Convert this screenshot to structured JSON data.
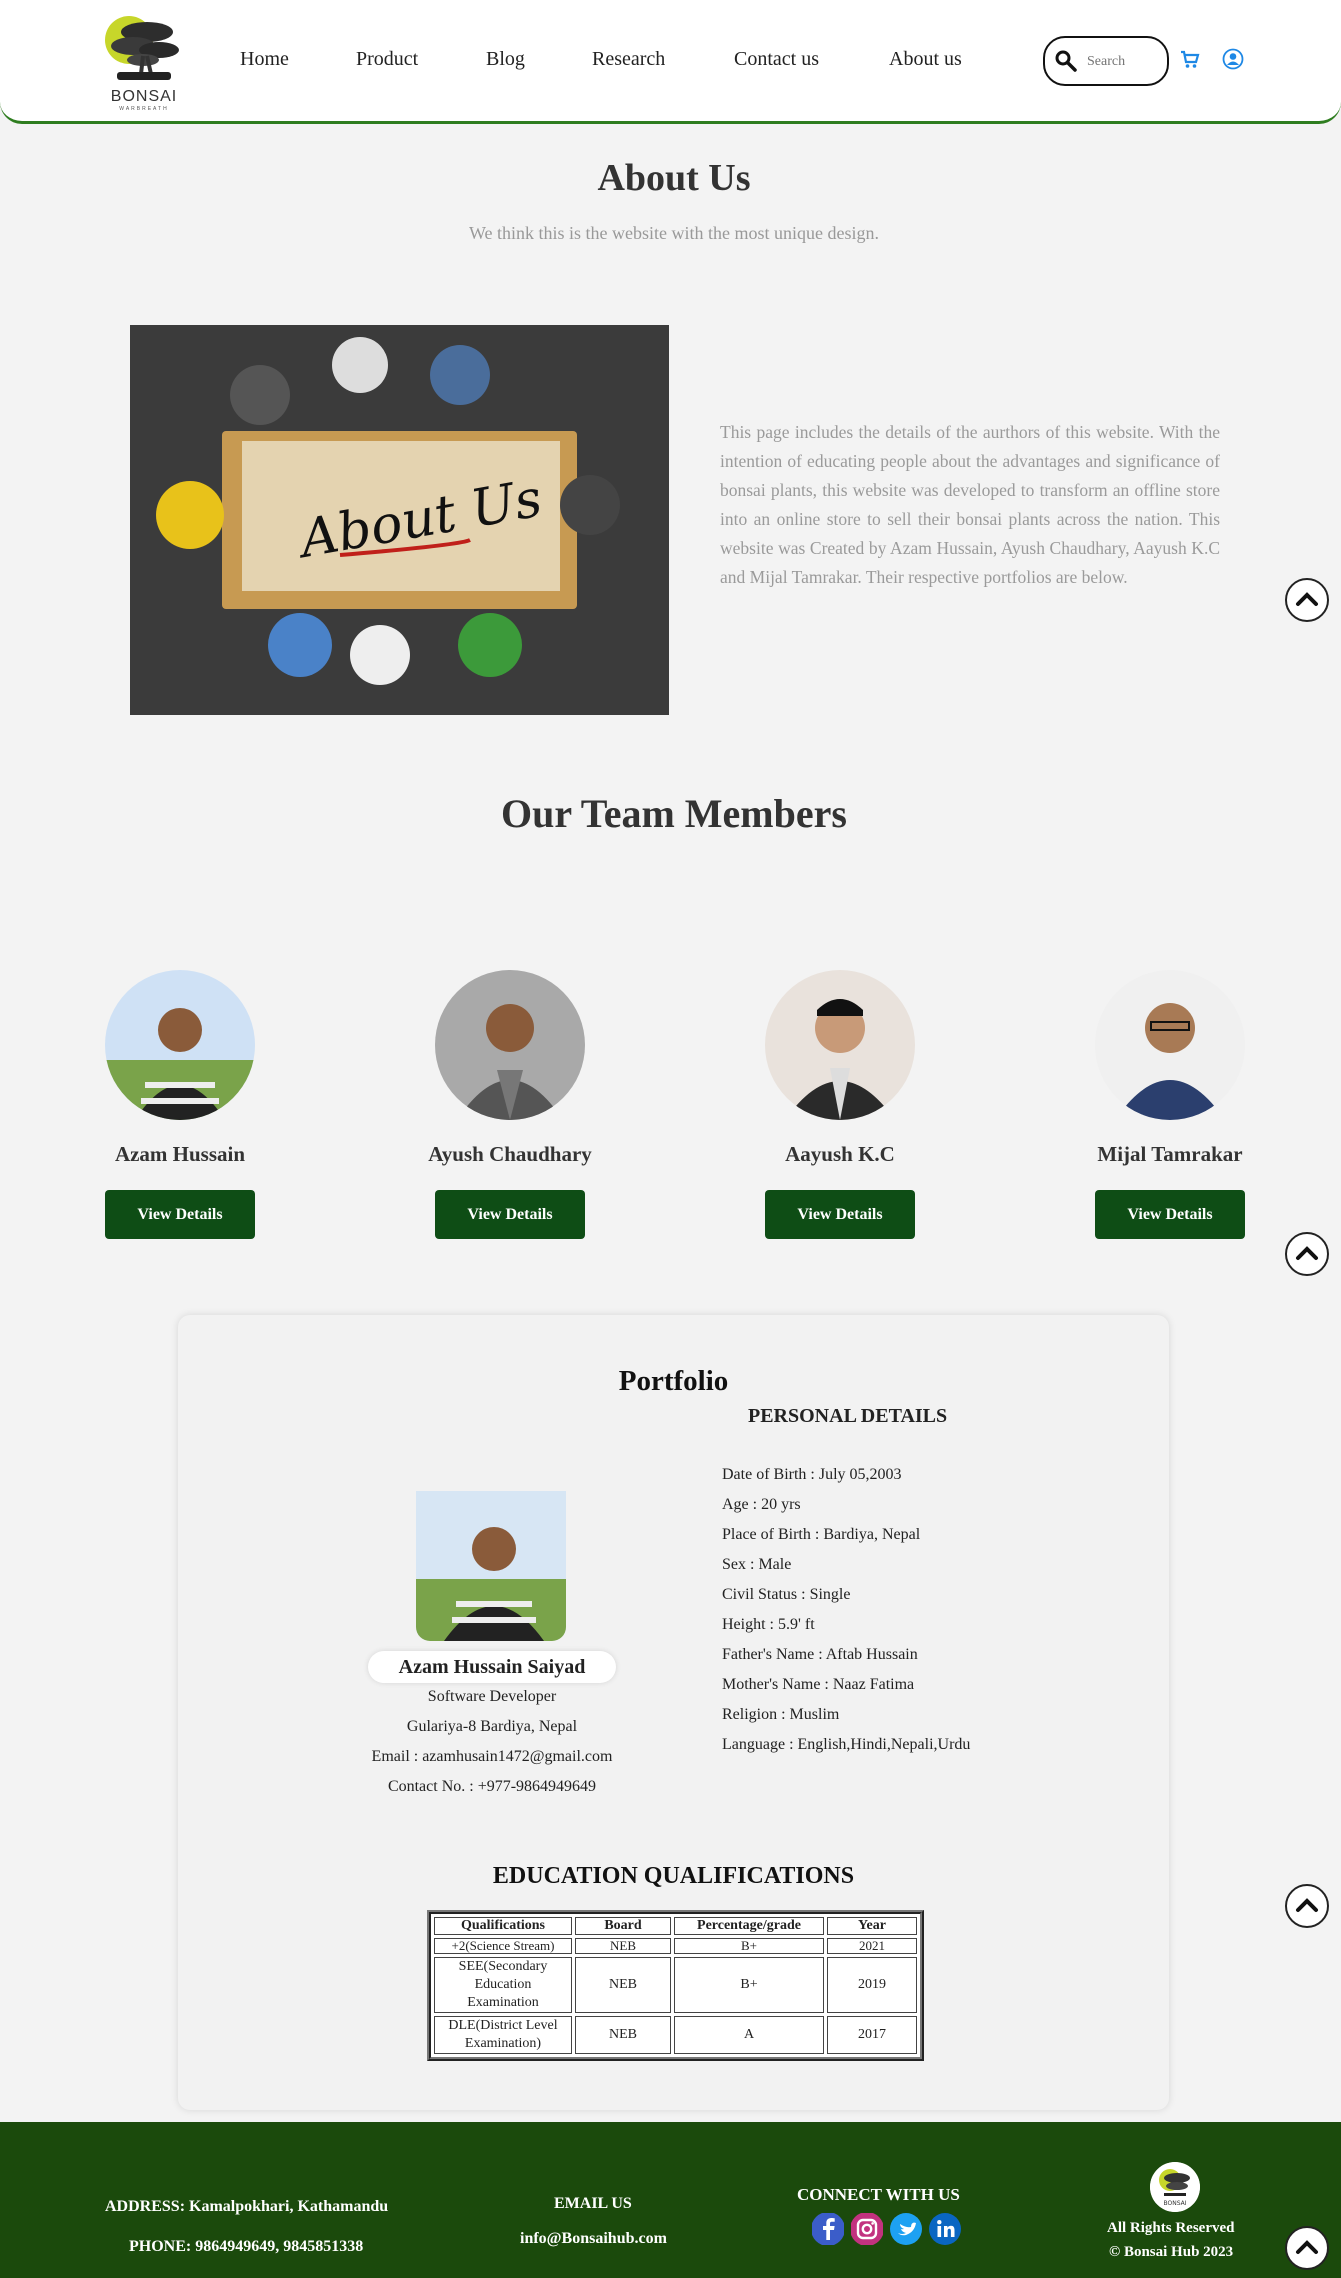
{
  "header": {
    "brand": "BONSAI",
    "brand_sub": "WARBREATH",
    "nav": [
      "Home",
      "Product",
      "Blog",
      "Research",
      "Contact us",
      "About us"
    ],
    "search_placeholder": "Search"
  },
  "about": {
    "title": "About Us",
    "subtitle": "We think this is the website with the most unique design.",
    "image_caption": "About Us",
    "text": "This page includes the details of the aurthors of this website. With the intention of educating people about the advantages and significance of bonsai plants, this website was developed to transform an offline store into an online store to sell their bonsai plants across the nation. This website was Created by Azam Hussain, Ayush Chaudhary, Aayush K.C and Mijal Tamrakar. Their respective portfolios are below."
  },
  "team": {
    "title": "Our Team Members",
    "button_label": "View Details",
    "members": [
      {
        "name": "Azam Hussain"
      },
      {
        "name": "Ayush Chaudhary"
      },
      {
        "name": "Aayush K.C"
      },
      {
        "name": "Mijal Tamrakar"
      }
    ]
  },
  "portfolio": {
    "title": "Portfolio",
    "personal_heading": "PERSONAL DETAILS",
    "name": "Azam Hussain Saiyad",
    "role": "Software Developer",
    "address": "Gulariya-8 Bardiya, Nepal",
    "email": "Email : azamhusain1472@gmail.com",
    "contact": "Contact No. : +977-9864949649",
    "details": [
      "Date of Birth : July 05,2003",
      "Age : 20 yrs",
      "Place of Birth : Bardiya, Nepal",
      "Sex : Male",
      "Civil Status : Single",
      "Height : 5.9' ft",
      "Father's Name : Aftab Hussain",
      "Mother's Name : Naaz Fatima",
      "Religion : Muslim",
      "Language : English,Hindi,Nepali,Urdu"
    ],
    "education_heading": "EDUCATION QUALIFICATIONS",
    "table": {
      "headers": [
        "Qualifications",
        "Board",
        "Percentage/grade",
        "Year"
      ],
      "rows": [
        [
          "+2(Science Stream)",
          "NEB",
          "B+",
          "2021"
        ],
        [
          "SEE(Secondary Education Examination",
          "NEB",
          "B+",
          "2019"
        ],
        [
          "DLE(District Level Examination)",
          "NEB",
          "A",
          "2017"
        ]
      ]
    }
  },
  "footer": {
    "address": "ADDRESS: Kamalpokhari, Kathamandu",
    "phone": "PHONE: 9864949649, 9845851338",
    "email_heading": "EMAIL US",
    "email": "info@Bonsaihub.com",
    "connect": "CONNECT WITH US",
    "logo_text": "BONSAI",
    "rights": "All Rights Reserved",
    "copyright": "© Bonsai Hub 2023"
  },
  "colors": {
    "accent": "#0e4d15",
    "footer_bg": "#1b4a0c",
    "header_border": "#2e7d1f"
  },
  "icons": [
    "search-icon",
    "cart-icon",
    "user-icon",
    "chevron-up-icon",
    "facebook-icon",
    "instagram-icon",
    "twitter-icon",
    "linkedin-icon"
  ]
}
